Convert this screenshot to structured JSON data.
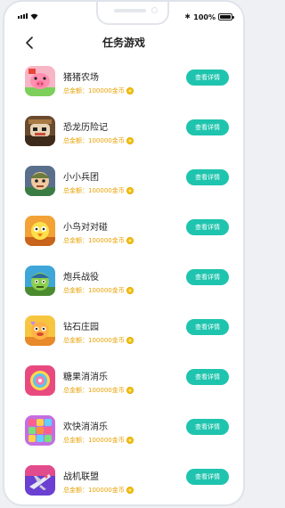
{
  "status_bar": {
    "battery_text": "100%",
    "bluetooth_symbol": "∗"
  },
  "header": {
    "title": "任务游戏",
    "back_icon": "chevron-left-icon"
  },
  "colors": {
    "accent": "#1fc4ae",
    "reward": "#e6a100",
    "coin": "#f5c518"
  },
  "games": [
    {
      "name": "猪猪农场",
      "reward": "总金额：100000金币",
      "button": "查看详情",
      "icon": "pig-farm-icon"
    },
    {
      "name": "恐龙历险记",
      "reward": "总金额：100000金币",
      "button": "查看详情",
      "icon": "dinosaur-icon"
    },
    {
      "name": "小小兵团",
      "reward": "总金额：100000金币",
      "button": "查看详情",
      "icon": "soldier-icon"
    },
    {
      "name": "小鸟对对碰",
      "reward": "总金额：100000金币",
      "button": "查看详情",
      "icon": "bird-icon"
    },
    {
      "name": "炮兵战役",
      "reward": "总金额：100000金币",
      "button": "查看详情",
      "icon": "artillery-icon"
    },
    {
      "name": "钻石庄园",
      "reward": "总金额：100000金币",
      "button": "查看详情",
      "icon": "diamond-manor-icon"
    },
    {
      "name": "糖果消消乐",
      "reward": "总金额：100000金币",
      "button": "查看详情",
      "icon": "candy-icon"
    },
    {
      "name": "欢快消消乐",
      "reward": "总金额：100000金币",
      "button": "查看详情",
      "icon": "happy-match-icon"
    },
    {
      "name": "战机联盟",
      "reward": "总金额：100000金币",
      "button": "查看详情",
      "icon": "fighter-jet-icon"
    }
  ]
}
